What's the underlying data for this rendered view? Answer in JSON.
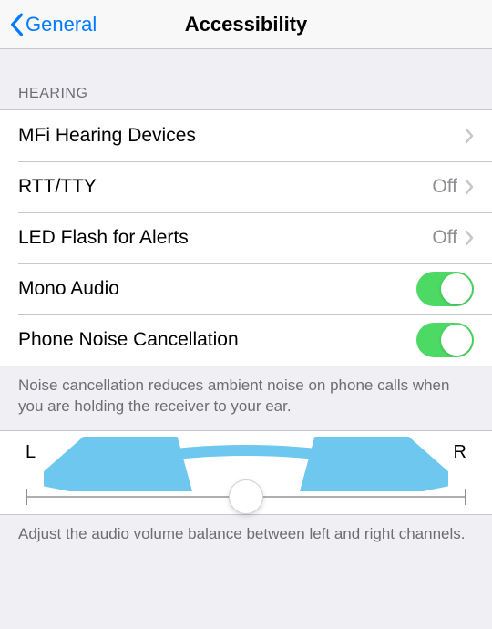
{
  "nav": {
    "back_label": "General",
    "title": "Accessibility"
  },
  "section": {
    "header": "HEARING",
    "footer_noise": "Noise cancellation reduces ambient noise on phone calls when you are holding the receiver to your ear.",
    "footer_balance": "Adjust the audio volume balance between left and right channels."
  },
  "rows": {
    "mfi": {
      "label": "MFi Hearing Devices",
      "value": ""
    },
    "rtt": {
      "label": "RTT/TTY",
      "value": "Off"
    },
    "led": {
      "label": "LED Flash for Alerts",
      "value": "Off"
    },
    "mono": {
      "label": "Mono Audio",
      "on": true
    },
    "noise": {
      "label": "Phone Noise Cancellation",
      "on": true
    }
  },
  "balance": {
    "left_label": "L",
    "right_label": "R"
  }
}
